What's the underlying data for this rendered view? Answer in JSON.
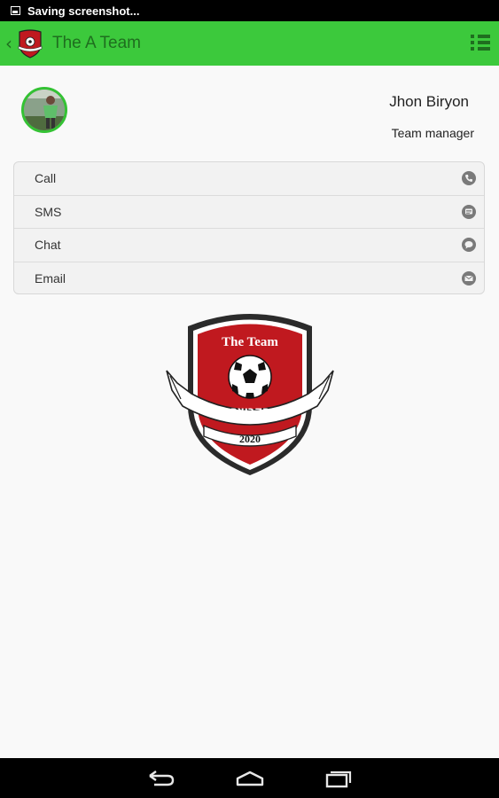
{
  "status_bar": {
    "notification_text": "Saving screenshot..."
  },
  "action_bar": {
    "title": "The A Team",
    "bg_color": "#3cc93c",
    "text_color": "#1f6e1f"
  },
  "contact": {
    "name": "Jhon Biryon",
    "role": "Team manager"
  },
  "actions": [
    {
      "label": "Call",
      "icon": "phone-icon"
    },
    {
      "label": "SMS",
      "icon": "sms-icon"
    },
    {
      "label": "Chat",
      "icon": "chat-icon"
    },
    {
      "label": "Email",
      "icon": "email-icon"
    }
  ],
  "crest": {
    "title": "The Team",
    "hebrew_text": "הקבוצה",
    "year": "2020",
    "color": "#c0191f"
  },
  "nav_bar": {
    "buttons": [
      "back-nav-icon",
      "home-nav-icon",
      "recents-nav-icon"
    ]
  }
}
